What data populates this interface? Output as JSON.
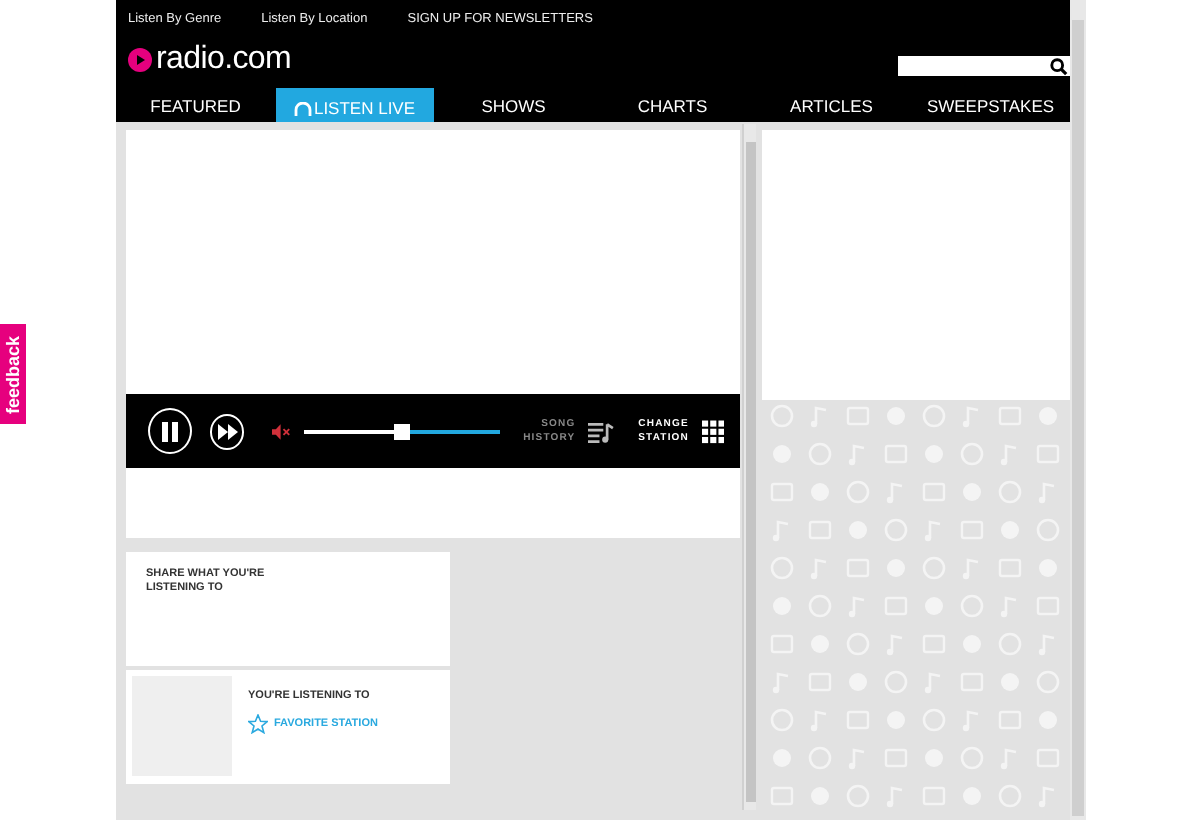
{
  "top_links": [
    "Listen By Genre",
    "Listen By Location",
    "SIGN UP FOR NEWSLETTERS"
  ],
  "logo": {
    "text": "radio.com"
  },
  "nav": [
    {
      "label": "FEATURED",
      "selected": false
    },
    {
      "label": "LISTEN LIVE",
      "selected": true
    },
    {
      "label": "SHOWS",
      "selected": false
    },
    {
      "label": "CHARTS",
      "selected": false
    },
    {
      "label": "ARTICLES",
      "selected": false
    },
    {
      "label": "SWEEPSTAKES",
      "selected": false
    }
  ],
  "player": {
    "playing": true,
    "muted": true,
    "level": 0.5,
    "song_history": [
      "SONG",
      "HISTORY"
    ],
    "change_station": [
      "CHANGE",
      "STATION"
    ]
  },
  "share": {
    "title": "SHARE WHAT YOU'RE LISTENING TO"
  },
  "listening": {
    "title": "YOU'RE LISTENING TO",
    "favorite": "FAVORITE STATION"
  },
  "feedback": "feedback"
}
